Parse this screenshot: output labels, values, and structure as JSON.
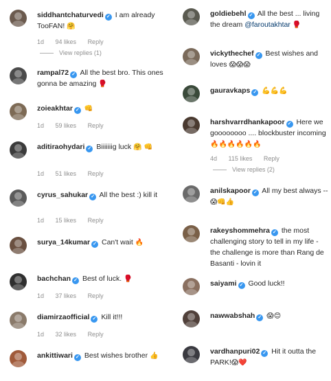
{
  "left": [
    {
      "user": "siddhantchaturvedi",
      "verified": true,
      "text": "I am already TooFAN!",
      "emoji": "🤗",
      "time": "1d",
      "likes": "94 likes",
      "reply": "Reply",
      "view_replies": "View replies (1)",
      "avatar_color": "#6b5a4e"
    },
    {
      "user": "rampal72",
      "verified": true,
      "text": "All the best bro. This ones gonna be amazing",
      "emoji": "🥊",
      "time": "",
      "likes": "",
      "reply": "",
      "view_replies": "",
      "avatar_color": "#4a4a4a"
    },
    {
      "user": "zoieakhtar",
      "verified": true,
      "text": "",
      "emoji": "👊",
      "time": "1d",
      "likes": "59 likes",
      "reply": "Reply",
      "view_replies": "",
      "avatar_color": "#7d6a55"
    },
    {
      "user": "aditiraohydari",
      "verified": true,
      "text": "Biiiiiiig luck",
      "emoji": "🤗 👊",
      "time": "1d",
      "likes": "51 likes",
      "reply": "Reply",
      "view_replies": "",
      "avatar_color": "#3b3b3b"
    },
    {
      "user": "cyrus_sahukar",
      "verified": true,
      "text": "All the best :) kill it",
      "emoji": "",
      "time": "1d",
      "likes": "15 likes",
      "reply": "Reply",
      "view_replies": "",
      "avatar_color": "#5a5a5a"
    },
    {
      "user": "surya_14kumar",
      "verified": true,
      "text": "Can't wait",
      "emoji": "🔥",
      "time": "",
      "likes": "",
      "reply": "",
      "view_replies": "",
      "avatar_color": "#6a5040"
    },
    {
      "user": "bachchan",
      "verified": true,
      "text": "Best of luck.",
      "emoji": "🥊",
      "time": "1d",
      "likes": "37 likes",
      "reply": "Reply",
      "view_replies": "",
      "avatar_color": "#2f2f2f"
    },
    {
      "user": "diamirzaofficial",
      "verified": true,
      "text": "Kill it!!!",
      "emoji": "",
      "time": "1d",
      "likes": "32 likes",
      "reply": "Reply",
      "view_replies": "",
      "avatar_color": "#8a7a6a"
    },
    {
      "user": "ankittiwari",
      "verified": true,
      "text": "Best wishes brother",
      "emoji": "👍",
      "time": "",
      "likes": "",
      "reply": "",
      "view_replies": "",
      "avatar_color": "#a05a3a"
    }
  ],
  "right": [
    {
      "user": "goldiebehl",
      "verified": true,
      "text": "All the best ... living the dream",
      "mention": "@faroutakhtar",
      "emoji": "🥊",
      "time": "",
      "likes": "",
      "reply": "",
      "view_replies": "",
      "avatar_color": "#5a5a50"
    },
    {
      "user": "vickythechef",
      "verified": true,
      "text": "Best wishes and loves",
      "emoji": "😱😱😱",
      "time": "",
      "likes": "",
      "reply": "",
      "view_replies": "",
      "avatar_color": "#7a6a5a"
    },
    {
      "user": "gauravkaps",
      "verified": true,
      "text": "",
      "emoji": "💪💪💪",
      "time": "",
      "likes": "",
      "reply": "",
      "view_replies": "",
      "avatar_color": "#3a4a3a"
    },
    {
      "user": "harshvarrdhankapoor",
      "verified": true,
      "text": "Here we goooooooo .... blockbuster incoming",
      "emoji": "🔥🔥🔥🔥🔥🔥",
      "time": "4d",
      "likes": "115 likes",
      "reply": "Reply",
      "view_replies": "View replies (2)",
      "avatar_color": "#4a3a30"
    },
    {
      "user": "anilskapoor",
      "verified": true,
      "text": "All my best always --",
      "emoji": "😱👊👍",
      "time": "",
      "likes": "",
      "reply": "",
      "view_replies": "",
      "avatar_color": "#6a6a6a"
    },
    {
      "user": "rakeyshommehra",
      "verified": true,
      "text": "the most challenging story to tell in my life - the challenge is more than Rang de Basanti - lovin it",
      "emoji": "",
      "time": "",
      "likes": "",
      "reply": "",
      "view_replies": "",
      "avatar_color": "#7a6048"
    },
    {
      "user": "saiyami",
      "verified": true,
      "text": "Good luck!!",
      "emoji": "",
      "time": "",
      "likes": "",
      "reply": "",
      "view_replies": "",
      "avatar_color": "#8a7060"
    },
    {
      "user": "nawwabshah",
      "verified": true,
      "text": "",
      "emoji": "😱😊",
      "time": "",
      "likes": "",
      "reply": "",
      "view_replies": "",
      "avatar_color": "#50403a"
    },
    {
      "user": "vardhanpuri02",
      "verified": true,
      "text": "Hit it outta the PARK!",
      "emoji": "😱❤️",
      "time": "",
      "likes": "",
      "reply": "",
      "view_replies": "",
      "avatar_color": "#3a3a40"
    }
  ],
  "verified_color": "#3897f0"
}
